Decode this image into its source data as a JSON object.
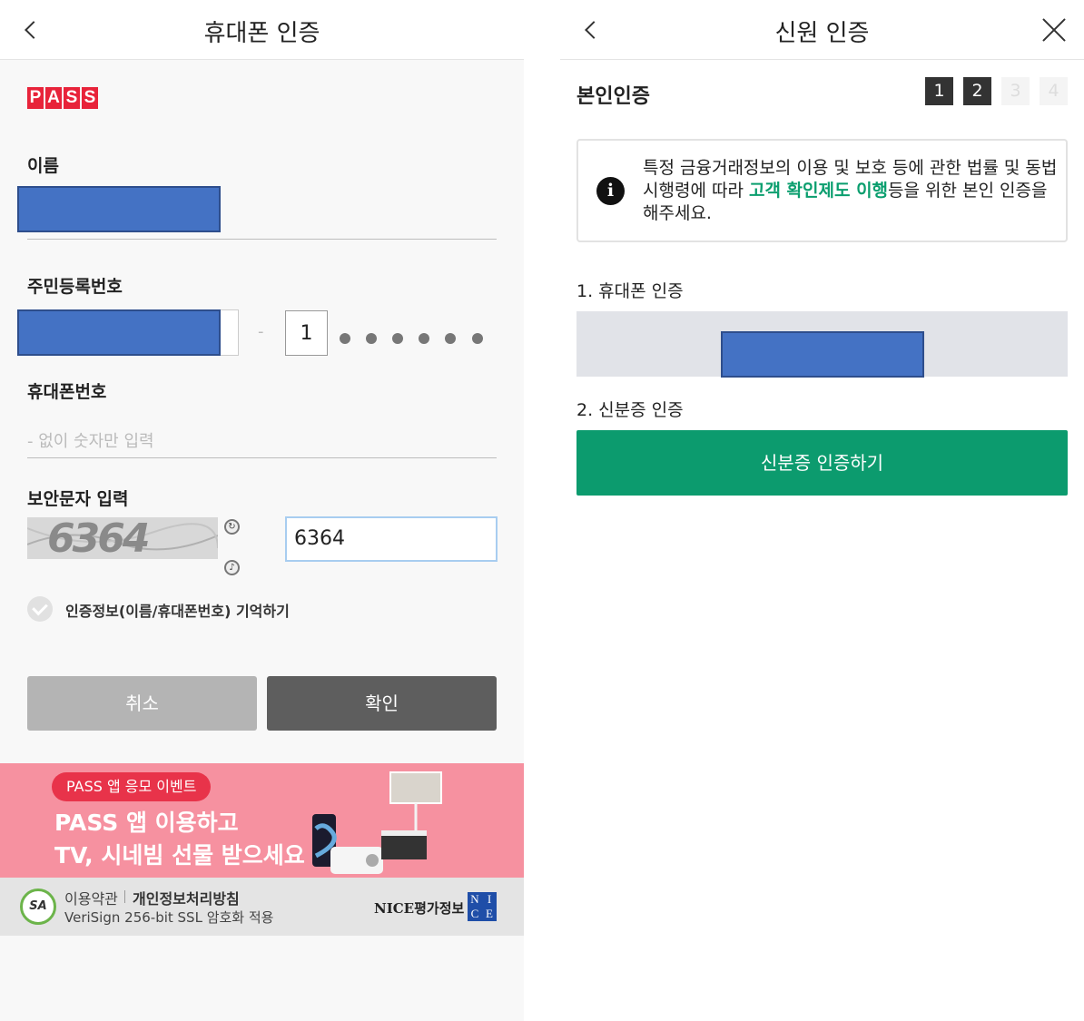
{
  "left": {
    "header_title": "휴대폰 인증",
    "logo_letters": [
      "P",
      "A",
      "S",
      "S"
    ],
    "name_label": "이름",
    "rrn_label": "주민등록번호",
    "rrn_separator": "-",
    "rrn_back_first_digit": "1",
    "phone_label": "휴대폰번호",
    "phone_placeholder": "- 없이 숫자만 입력",
    "security_label": "보안문자 입력",
    "captcha_text": "6364",
    "security_input_value": "6364",
    "remember_label": "인증정보(이름/휴대폰번호) 기억하기",
    "cancel_label": "취소",
    "confirm_label": "확인",
    "banner": {
      "pill": "PASS 앱 응모 이벤트",
      "line1": "PASS 앱 이용하고",
      "line2": "TV, 시네빔 선물 받으세요"
    },
    "footer": {
      "badge": "SA",
      "terms": "이용약관",
      "privacy": "개인정보처리방침",
      "ssl": "VeriSign 256-bit SSL 암호화 적용",
      "nice_text": "NICE평가정보",
      "nice_logo": [
        "N",
        "I",
        "C",
        "E"
      ]
    },
    "colors": {
      "pass_red": "#e8233a",
      "banner_pink": "#f691a0",
      "redaction_blue": "#4472c4"
    }
  },
  "right": {
    "header_title": "신원 인증",
    "section_title": "본인인증",
    "steps": [
      {
        "label": "1",
        "active": true
      },
      {
        "label": "2",
        "active": true
      },
      {
        "label": "3",
        "active": false
      },
      {
        "label": "4",
        "active": false
      }
    ],
    "info": {
      "icon": "i",
      "text_before": "특정 금융거래정보의 이용 및 보호 등에 관한 법률 및 동법 시행령에 따라 ",
      "highlight": "고객 확인제도 이행",
      "text_after": "등을 위한 본인 인증을 해주세요."
    },
    "step1_label": "1. 휴대폰 인증",
    "step2_label": "2. 신분증 인증",
    "id_button_label": "신분증 인증하기",
    "colors": {
      "accent_green": "#0c9b6e",
      "highlight_green": "#0a9e6e"
    }
  }
}
